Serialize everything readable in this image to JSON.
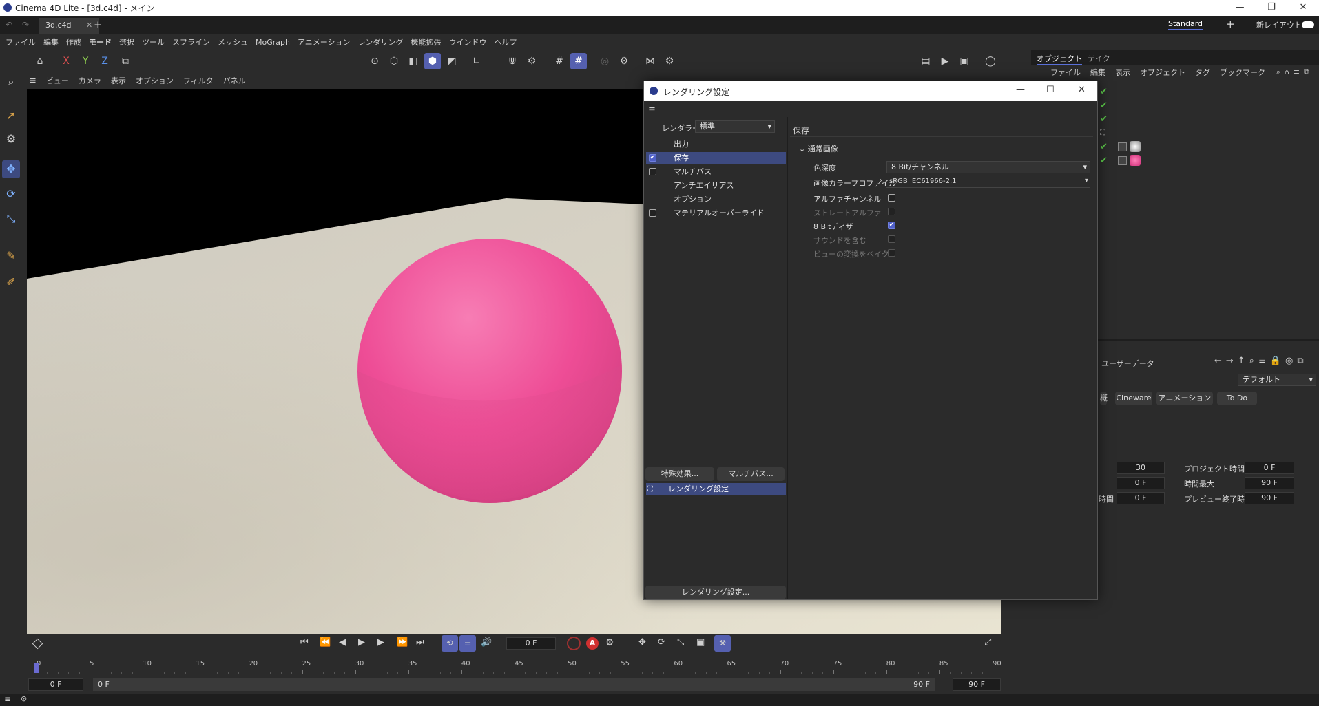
{
  "window": {
    "title": "Cinema 4D Lite - [3d.c4d] - メイン",
    "minimize": "—",
    "maximize": "❐",
    "close": "✕"
  },
  "tabs": {
    "active": "3d.c4d",
    "close": "✕",
    "add": "+",
    "layout": "Standard",
    "layout_add": "+",
    "new_layout": "新レイアウト"
  },
  "menu": [
    "ファイル",
    "編集",
    "作成",
    "モード",
    "選択",
    "ツール",
    "スプライン",
    "メッシュ",
    "MoGraph",
    "アニメーション",
    "レンダリング",
    "機能拡張",
    "ウインドウ",
    "ヘルプ"
  ],
  "toolbar": {
    "x": "X",
    "y": "Y",
    "z": "Z"
  },
  "view_menu": [
    "ビュー",
    "カメラ",
    "表示",
    "オプション",
    "フィルタ",
    "パネル"
  ],
  "timeline": {
    "current_frame": "0 F",
    "ticks": [
      "0",
      "5",
      "10",
      "15",
      "20",
      "25",
      "30",
      "35",
      "40",
      "45",
      "50",
      "55",
      "60",
      "65",
      "70",
      "75",
      "80",
      "85",
      "90"
    ],
    "start": "0 F",
    "range_start": "0 F",
    "range_end": "90 F",
    "end": "90 F"
  },
  "object_manager": {
    "tabs": [
      "オブジェクト",
      "テイク"
    ],
    "menu": [
      "ファイル",
      "編集",
      "表示",
      "オブジェクト",
      "タグ",
      "ブックマーク"
    ]
  },
  "attribute_manager": {
    "userdata": "ユーザーデータ",
    "default": "デフォルト",
    "tabs": [
      "概",
      "Cineware",
      "アニメーション",
      "To Do"
    ],
    "fps_value": "30",
    "project_time_label": "プロジェクト時間",
    "project_time_value": "0 F",
    "min_value": "0 F",
    "max_label": "時間最大",
    "max_value": "90 F",
    "preview_label_suffix": "時間",
    "preview_start_value": "0 F",
    "preview_end_label": "プレビュー終了時間",
    "preview_end_value": "90 F"
  },
  "dialog": {
    "title": "レンダリング設定",
    "renderer_label": "レンダラー",
    "renderer_value": "標準",
    "categories": [
      {
        "label": "出力",
        "checkbox": false,
        "selected": false
      },
      {
        "label": "保存",
        "checkbox": true,
        "checked": true,
        "selected": true
      },
      {
        "label": "マルチパス",
        "checkbox": true,
        "checked": false,
        "selected": false
      },
      {
        "label": "アンチエイリアス",
        "checkbox": false,
        "selected": false
      },
      {
        "label": "オプション",
        "checkbox": false,
        "selected": false
      },
      {
        "label": "マテリアルオーバーライド",
        "checkbox": true,
        "checked": false,
        "selected": false
      }
    ],
    "effects_button": "特殊効果...",
    "multipass_button": "マルチパス...",
    "preset_name": "レンダリング設定",
    "settings_button": "レンダリング設定...",
    "section_title": "保存",
    "group_title": "通常画像",
    "props": {
      "depth_label": "色深度",
      "depth_value": "8 Bit/チャンネル",
      "profile_label": "画像カラープロファイル",
      "profile_value": "sRGB IEC61966-2.1",
      "alpha_label": "アルファチャンネル",
      "straight_label": "ストレートアルファ",
      "dither_label": "8 Bitディザ",
      "sound_label": "サウンドを含む",
      "bake_label": "ビューの変換をベイク"
    }
  },
  "colors": {
    "accent": "#5560b0",
    "sphere": "#f0559a",
    "floor": "#d6d0c0",
    "check_green": "#5cc84a"
  }
}
